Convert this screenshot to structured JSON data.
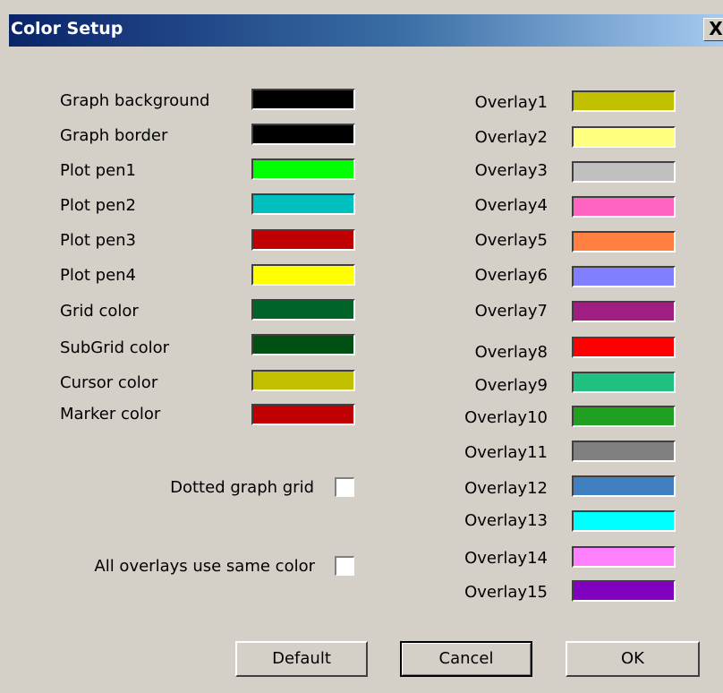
{
  "window": {
    "title": "Color Setup",
    "close_label": "X"
  },
  "left_colors": [
    {
      "label": "Graph background",
      "color": "#000000"
    },
    {
      "label": "Graph border",
      "color": "#000000"
    },
    {
      "label": "Plot pen1",
      "color": "#00ff00"
    },
    {
      "label": "Plot pen2",
      "color": "#00bfbf"
    },
    {
      "label": "Plot pen3",
      "color": "#c00000"
    },
    {
      "label": "Plot pen4",
      "color": "#ffff00"
    },
    {
      "label": "Grid color",
      "color": "#006428"
    },
    {
      "label": "SubGrid color",
      "color": "#005014"
    },
    {
      "label": "Cursor color",
      "color": "#c0c000"
    },
    {
      "label": "Marker color",
      "color": "#c00000"
    }
  ],
  "options": {
    "dotted_grid_label": "Dotted graph grid",
    "dotted_grid_checked": false,
    "same_color_label": "All overlays use same color",
    "same_color_checked": false
  },
  "overlays": [
    {
      "label": "Overlay1",
      "color": "#c0c000"
    },
    {
      "label": "Overlay2",
      "color": "#ffff80"
    },
    {
      "label": "Overlay3",
      "color": "#c0c0c0"
    },
    {
      "label": "Overlay4",
      "color": "#ff64c0"
    },
    {
      "label": "Overlay5",
      "color": "#ff8040"
    },
    {
      "label": "Overlay6",
      "color": "#8080ff"
    },
    {
      "label": "Overlay7",
      "color": "#a01e82"
    },
    {
      "label": "Overlay8",
      "color": "#ff0000"
    },
    {
      "label": "Overlay9",
      "color": "#20c080"
    },
    {
      "label": "Overlay10",
      "color": "#20a020"
    },
    {
      "label": "Overlay11",
      "color": "#808080"
    },
    {
      "label": "Overlay12",
      "color": "#4080c0"
    },
    {
      "label": "Overlay13",
      "color": "#00ffff"
    },
    {
      "label": "Overlay14",
      "color": "#ff80ff"
    },
    {
      "label": "Overlay15",
      "color": "#8000c0"
    }
  ],
  "buttons": {
    "default_label": "Default",
    "cancel_label": "Cancel",
    "ok_label": "OK"
  }
}
